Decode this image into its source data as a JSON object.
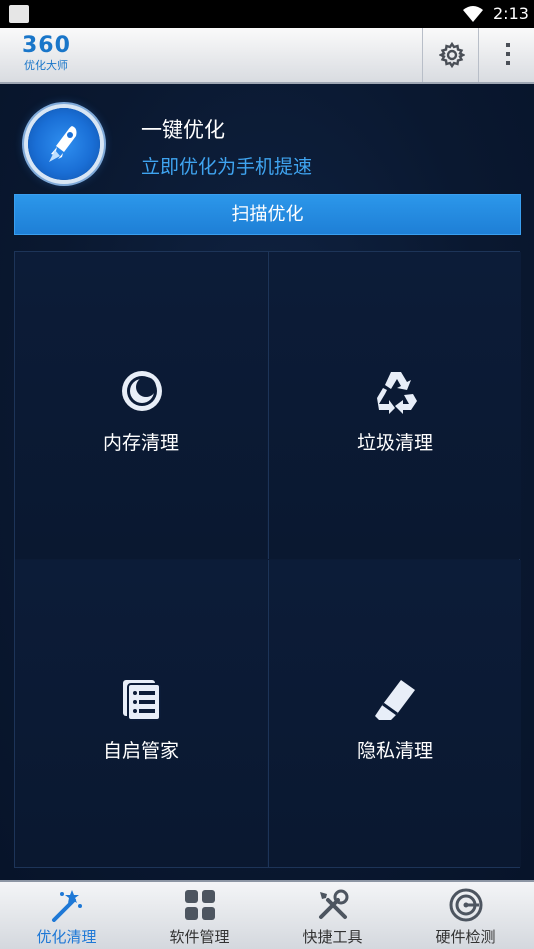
{
  "status_bar": {
    "time": "2:13"
  },
  "header": {
    "logo_number": "360",
    "logo_subtitle": "优化大师",
    "settings_icon": "gear-icon",
    "more_icon": "overflow-menu-icon"
  },
  "one_click": {
    "title": "一键优化",
    "subtitle": "立即优化为手机提速",
    "button_label": "扫描优化"
  },
  "grid": {
    "items": [
      {
        "label": "内存清理",
        "icon": "memory-clean-icon"
      },
      {
        "label": "垃圾清理",
        "icon": "recycle-icon"
      },
      {
        "label": "自启管家",
        "icon": "startup-list-icon"
      },
      {
        "label": "隐私清理",
        "icon": "eraser-icon"
      }
    ]
  },
  "tabs": [
    {
      "label": "优化清理",
      "icon": "magic-wand-icon",
      "active": true
    },
    {
      "label": "软件管理",
      "icon": "app-grid-icon",
      "active": false
    },
    {
      "label": "快捷工具",
      "icon": "tools-icon",
      "active": false
    },
    {
      "label": "硬件检测",
      "icon": "hardware-detect-icon",
      "active": false
    }
  ],
  "colors": {
    "accent": "#1e7fd6",
    "subtitle": "#3fa4f0",
    "background": "#0b1a33"
  }
}
